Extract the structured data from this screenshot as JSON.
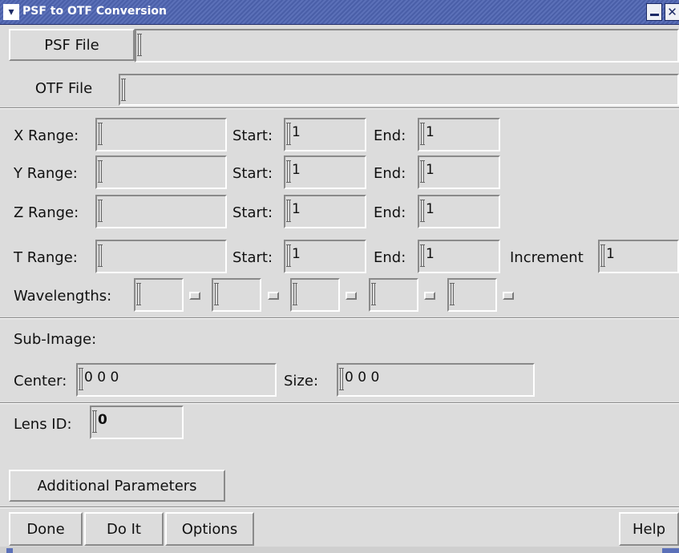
{
  "window": {
    "title": "PSF to OTF Conversion",
    "menu_icon": "chevron-down-icon",
    "minimize_icon": "minimize-icon",
    "close_glyph": "✕",
    "close_icon": "close-icon"
  },
  "files": {
    "psf_button": "PSF File",
    "psf_value": "",
    "otf_button": "OTF File",
    "otf_value": ""
  },
  "ranges": [
    {
      "label": "X Range:",
      "value": "",
      "start_label": "Start:",
      "start": "1",
      "end_label": "End:",
      "end": "1"
    },
    {
      "label": "Y Range:",
      "value": "",
      "start_label": "Start:",
      "start": "1",
      "end_label": "End:",
      "end": "1"
    },
    {
      "label": "Z Range:",
      "value": "",
      "start_label": "Start:",
      "start": "1",
      "end_label": "End:",
      "end": "1"
    },
    {
      "label": "T Range:",
      "value": "",
      "start_label": "Start:",
      "start": "1",
      "end_label": "End:",
      "end": "1"
    }
  ],
  "increment": {
    "label": "Increment",
    "value": "1"
  },
  "wavelengths": {
    "label": "Wavelengths:",
    "values": [
      "",
      "",
      "",
      "",
      ""
    ],
    "checked": [
      false,
      false,
      false,
      false,
      false
    ]
  },
  "subimage": {
    "heading": "Sub-Image:",
    "center_label": "Center:",
    "center_value": "0 0 0",
    "size_label": "Size:",
    "size_value": "0 0 0"
  },
  "lens": {
    "label": "Lens ID:",
    "value": "0"
  },
  "additional_button": "Additional Parameters",
  "footer": {
    "done": "Done",
    "do_it": "Do It",
    "options": "Options",
    "help": "Help"
  },
  "colors": {
    "title_bar": "#4a5fa8",
    "background": "#dcdcdc"
  }
}
